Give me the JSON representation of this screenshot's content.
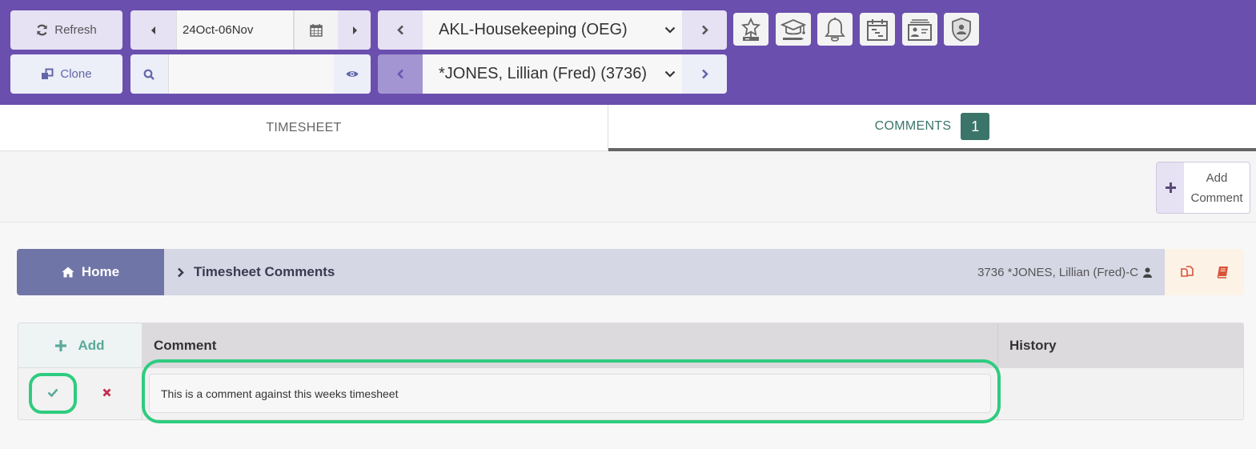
{
  "toolbar": {
    "refresh_label": "Refresh",
    "clone_label": "Clone",
    "date_range": "24Oct-06Nov",
    "search_value": "",
    "location_select": "AKL-Housekeeping (OEG)",
    "employee_select": "*JONES, Lillian (Fred) (3736)",
    "icon_buttons": [
      "award-icon",
      "training-icon",
      "notifications-icon",
      "roster-calendar-icon",
      "employee-card-icon",
      "security-shield-icon"
    ]
  },
  "tabs": [
    {
      "label": "TIMESHEET",
      "active": false
    },
    {
      "label": "COMMENTS",
      "active": true,
      "badge": "1"
    }
  ],
  "actions": {
    "add_comment_label": "Add\nComment"
  },
  "breadcrumb": {
    "home_label": "Home",
    "current_label": "Timesheet Comments",
    "employee_label": "3736 *JONES, Lillian (Fred)-C"
  },
  "grid": {
    "add_label": "Add",
    "columns": [
      "Comment",
      "History"
    ],
    "rows": [
      {
        "comment": "This is a comment against this weeks timesheet",
        "history": ""
      }
    ]
  },
  "colors": {
    "header_bg": "#6a4fae",
    "accent_teal": "#3b7569",
    "highlight_green": "#2ecc7f",
    "delete_red": "#c0304f"
  }
}
